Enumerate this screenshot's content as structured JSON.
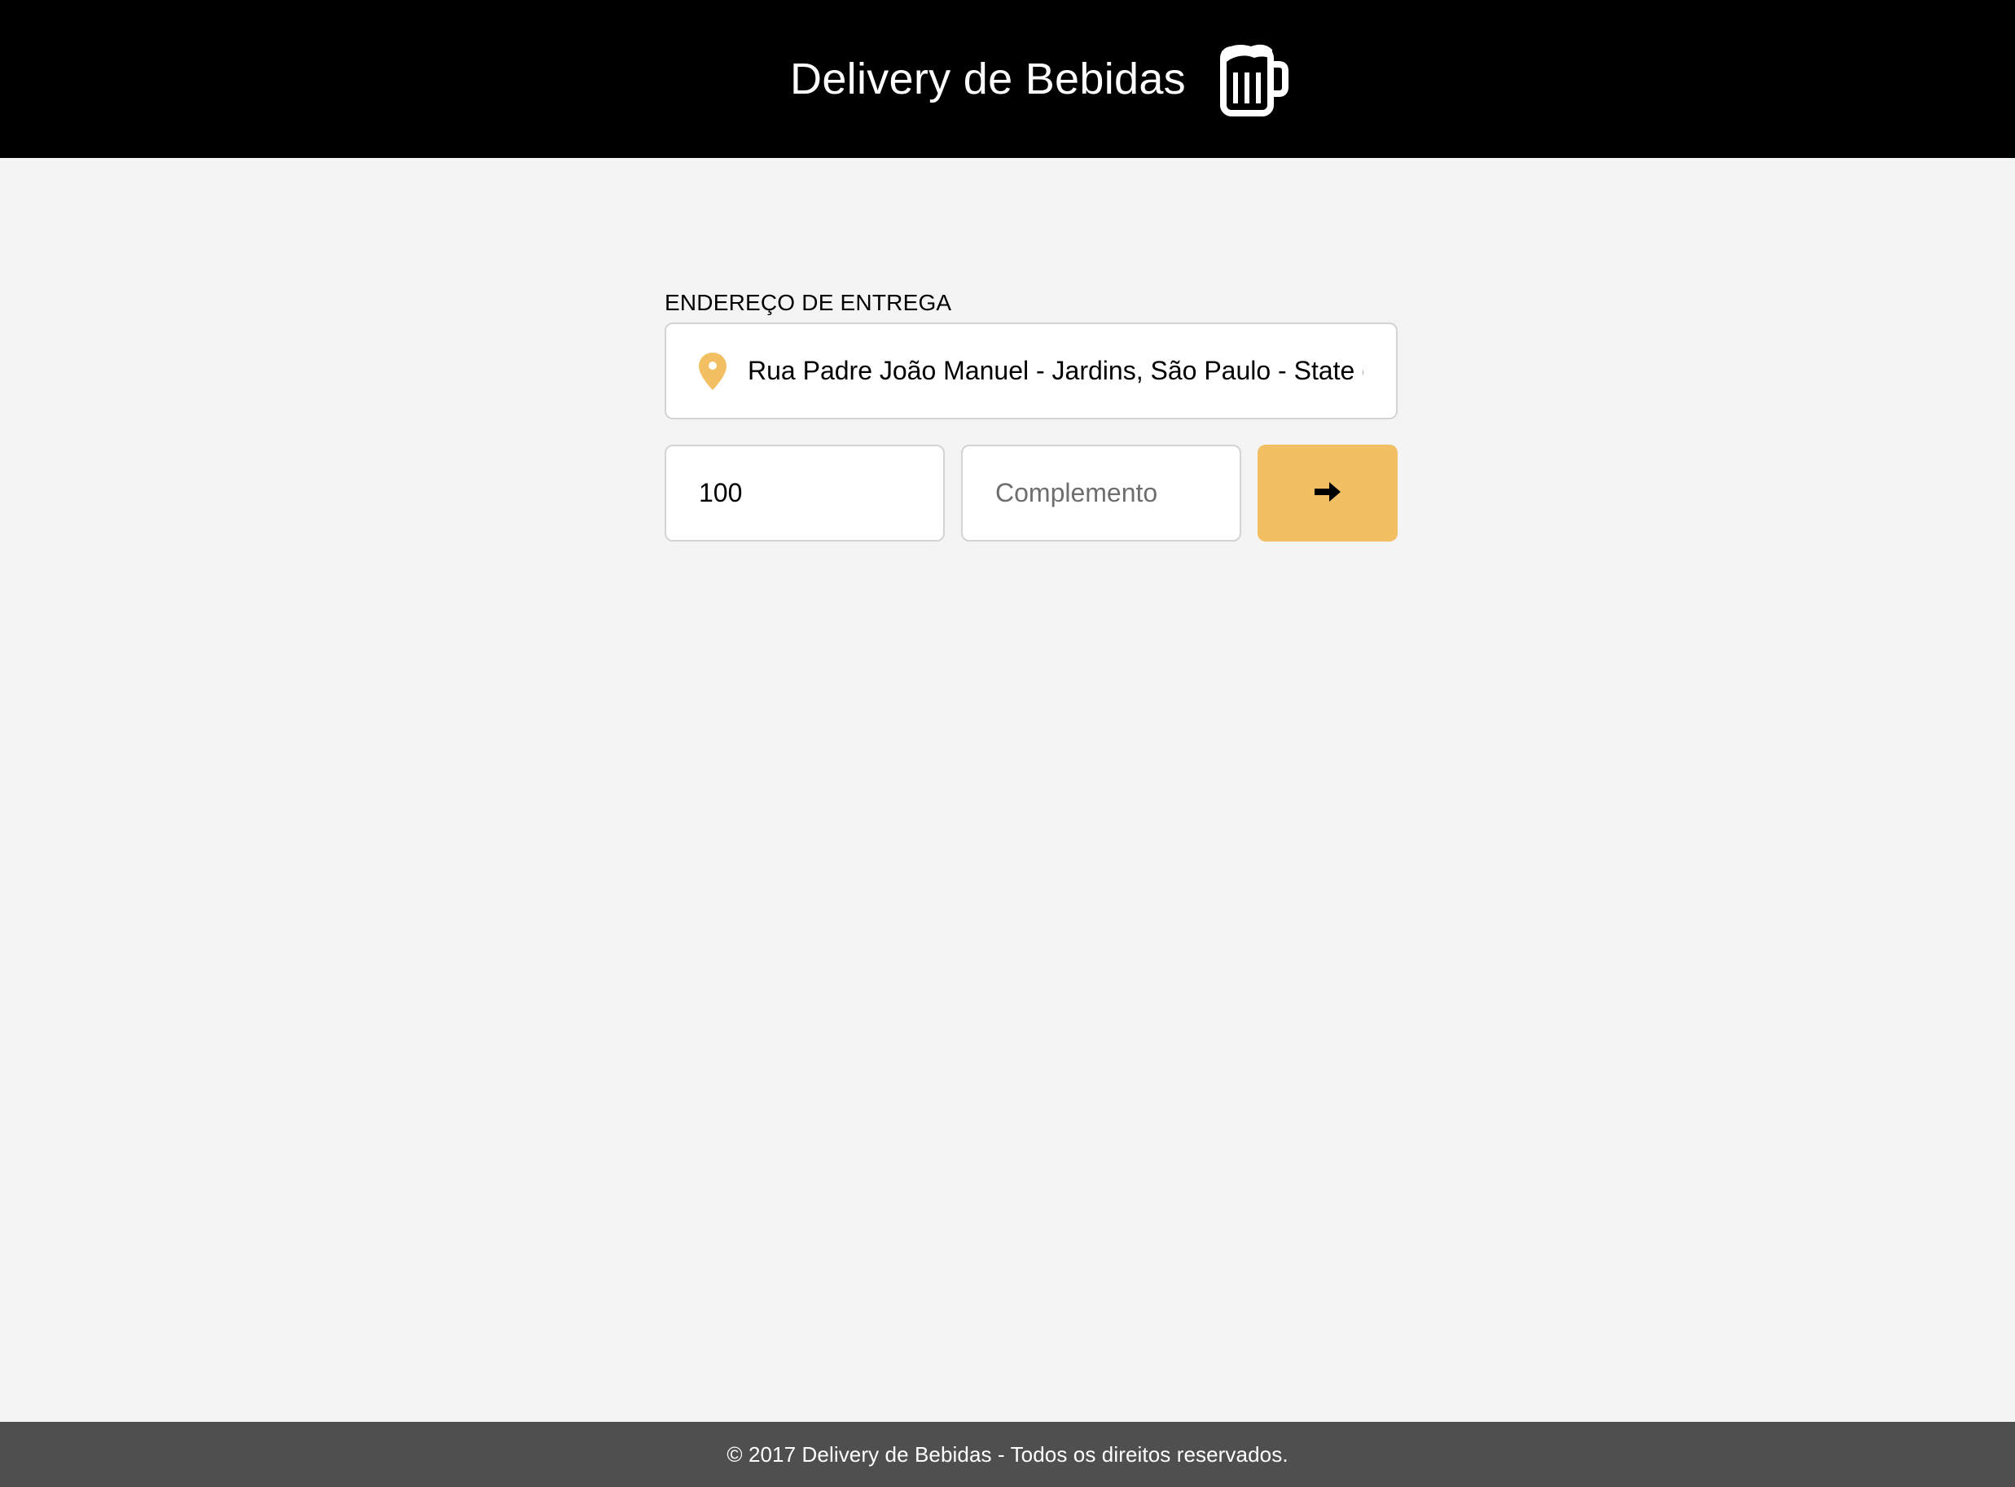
{
  "header": {
    "title": "Delivery de Bebidas",
    "icon": "beer-mug-icon",
    "background": "#000000"
  },
  "form": {
    "address_label": "ENDEREÇO DE ENTREGA",
    "address_value": "Rua Padre João Manuel - Jardins, São Paulo - State of São Paulo, Brazil",
    "address_icon": "map-pin-icon",
    "number_value": "100",
    "complement_placeholder": "Complemento",
    "submit_icon": "arrow-right-icon"
  },
  "colors": {
    "accent": "#f2c063",
    "page_background": "#f4f4f4",
    "footer_background": "#4f4f4f"
  },
  "footer": {
    "text": "© 2017 Delivery de Bebidas - Todos os direitos reservados."
  }
}
